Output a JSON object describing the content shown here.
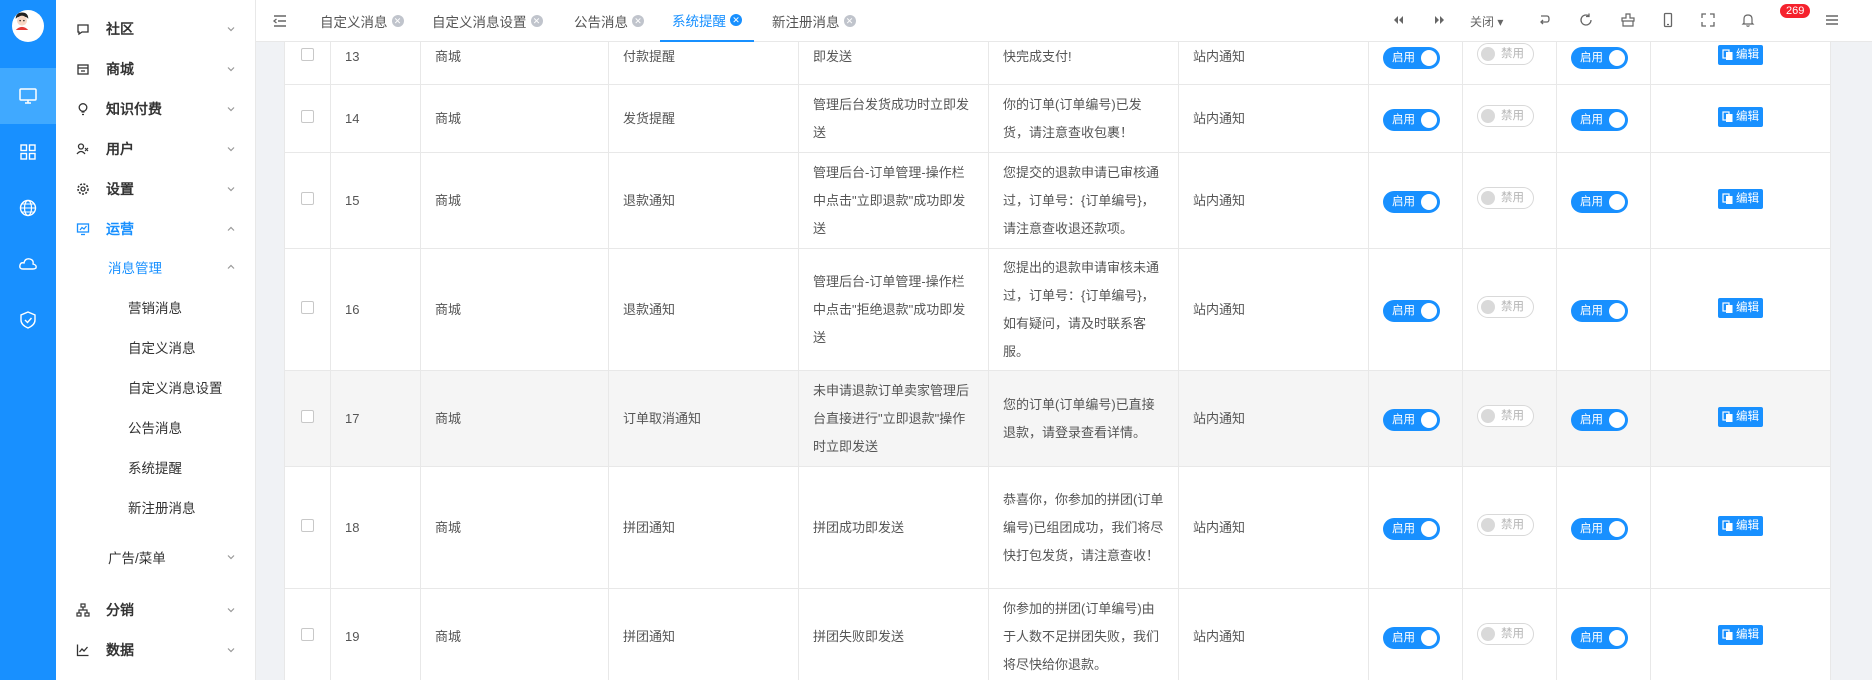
{
  "sidebar": {
    "items": [
      {
        "label": "社区",
        "icon": "chat-icon"
      },
      {
        "label": "商城",
        "icon": "store-icon"
      },
      {
        "label": "知识付费",
        "icon": "bulb-icon"
      },
      {
        "label": "用户",
        "icon": "users-icon"
      },
      {
        "label": "设置",
        "icon": "gear-icon"
      },
      {
        "label": "运营",
        "icon": "operations-icon"
      },
      {
        "label": "分销",
        "icon": "org-chart-icon"
      },
      {
        "label": "数据",
        "icon": "chart-line-icon"
      }
    ],
    "submenu": {
      "label": "消息管理",
      "items": [
        "营销消息",
        "自定义消息",
        "自定义消息设置",
        "公告消息",
        "系统提醒",
        "新注册消息"
      ]
    },
    "ads_menu": "广告/菜单"
  },
  "tabs": [
    "自定义消息",
    "自定义消息设置",
    "公告消息",
    "系统提醒",
    "新注册消息"
  ],
  "topbar": {
    "close_label": "关闭",
    "notification_count": "269"
  },
  "table": {
    "rows": [
      {
        "id": "13",
        "module": "商城",
        "name": "付款提醒",
        "trigger": "即发送",
        "content": "快完成支付!",
        "type": "站内通知",
        "sw1": "启用",
        "sw2": "禁用",
        "sw3": "启用",
        "edit": "编辑"
      },
      {
        "id": "14",
        "module": "商城",
        "name": "发货提醒",
        "trigger": "管理后台发货成功时立即发送",
        "content": "你的订单(订单编号)已发货，请注意查收包裹！",
        "type": "站内通知",
        "sw1": "启用",
        "sw2": "禁用",
        "sw3": "启用",
        "edit": "编辑"
      },
      {
        "id": "15",
        "module": "商城",
        "name": "退款通知",
        "trigger": "管理后台-订单管理-操作栏中点击\"立即退款\"成功即发送",
        "content": "您提交的退款申请已审核通过，订单号：{订单编号}，请注意查收退还款项。",
        "type": "站内通知",
        "sw1": "启用",
        "sw2": "禁用",
        "sw3": "启用",
        "edit": "编辑"
      },
      {
        "id": "16",
        "module": "商城",
        "name": "退款通知",
        "trigger": "管理后台-订单管理-操作栏中点击\"拒绝退款\"成功即发送",
        "content": "您提出的退款申请审核未通过，订单号：{订单编号}，如有疑问，请及时联系客服。",
        "type": "站内通知",
        "sw1": "启用",
        "sw2": "禁用",
        "sw3": "启用",
        "edit": "编辑"
      },
      {
        "id": "17",
        "module": "商城",
        "name": "订单取消通知",
        "trigger": "未申请退款订单卖家管理后台直接进行\"立即退款\"操作时立即发送",
        "content": "您的订单(订单编号)已直接退款，请登录查看详情。",
        "type": "站内通知",
        "sw1": "启用",
        "sw2": "禁用",
        "sw3": "启用",
        "edit": "编辑"
      },
      {
        "id": "18",
        "module": "商城",
        "name": "拼团通知",
        "trigger": "拼团成功即发送",
        "content": "恭喜你，你参加的拼团(订单编号)已组团成功，我们将尽快打包发货，请注意查收！",
        "type": "站内通知",
        "sw1": "启用",
        "sw2": "禁用",
        "sw3": "启用",
        "edit": "编辑"
      },
      {
        "id": "19",
        "module": "商城",
        "name": "拼团通知",
        "trigger": "拼团失败即发送",
        "content": "你参加的拼团(订单编号)由于人数不足拼团失败，我们将尽快给你退款。",
        "type": "站内通知",
        "sw1": "启用",
        "sw2": "禁用",
        "sw3": "启用",
        "edit": "编辑"
      }
    ]
  }
}
